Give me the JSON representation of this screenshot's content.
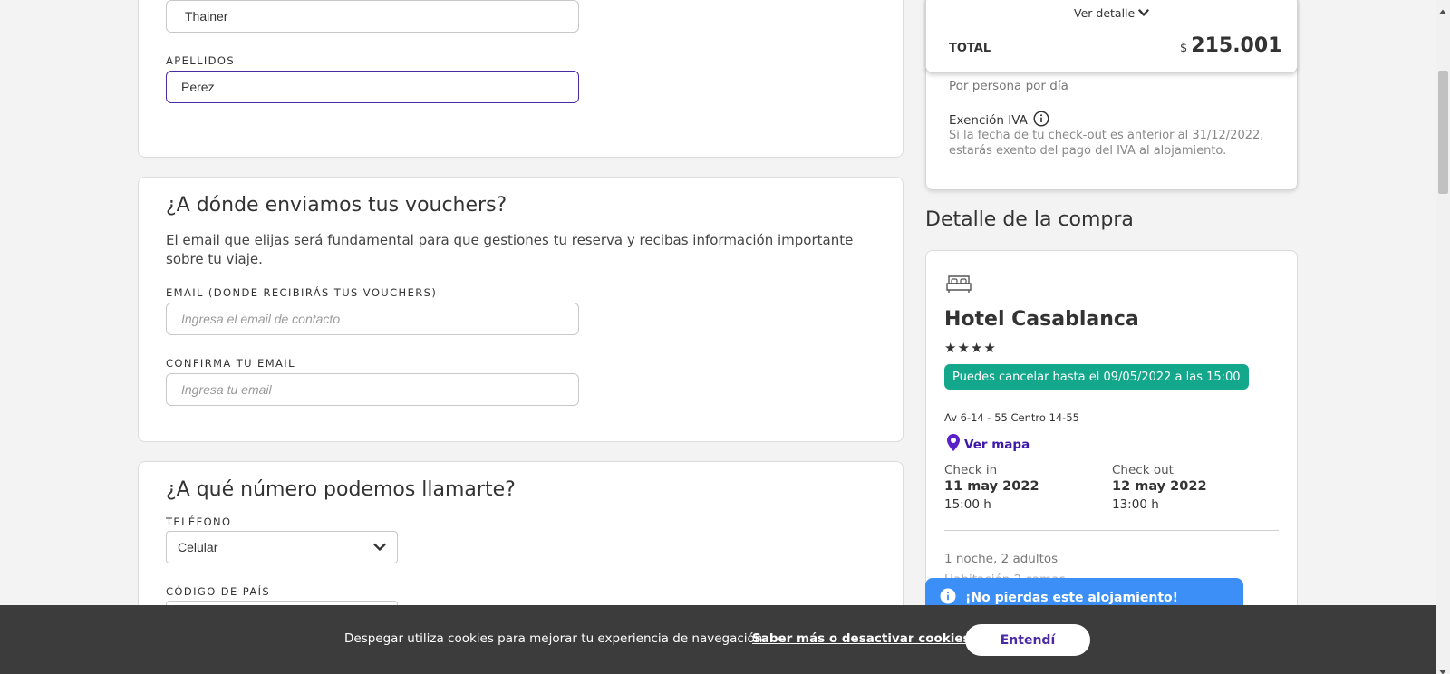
{
  "name_card": {
    "first_name_value": "Thainer",
    "last_name_label": "APELLIDOS",
    "last_name_value": "Perez"
  },
  "email_card": {
    "title": "¿A dónde enviamos tus vouchers?",
    "description": "El email que elijas será fundamental para que gestiones tu reserva y recibas información importante sobre tu viaje.",
    "email_label": "EMAIL (DONDE RECIBIRÁS TUS VOUCHERS)",
    "email_placeholder": "Ingresa el email de contacto",
    "confirm_label": "CONFIRMA TU EMAIL",
    "confirm_placeholder": "Ingresa tu email"
  },
  "phone_card": {
    "title": "¿A qué número podemos llamarte?",
    "phone_label": "TELÉFONO",
    "phone_type_value": "Celular",
    "country_code_label": "CÓDIGO DE PAÍS"
  },
  "price_box": {
    "ver_detalle": "Ver detalle",
    "total_label": "TOTAL",
    "currency": "$",
    "total_value": "215.001",
    "per_person": "Por persona por día",
    "iva_title": "Exención IVA",
    "iva_text": "Si la fecha de tu check-out es anterior al 31/12/2022, estarás exento del pago del IVA al alojamiento."
  },
  "purchase_detail": {
    "title": "Detalle de la compra",
    "hotel_name": "Hotel Casablanca",
    "stars": "★★★★",
    "cancel_badge": "Puedes cancelar hasta el 09/05/2022 a las 15:00",
    "address": "Av 6-14 - 55 Centro 14-55",
    "map_link": "Ver mapa",
    "checkin_label": "Check in",
    "checkin_date": "11 may 2022",
    "checkin_time": "15:00 h",
    "checkout_label": "Check out",
    "checkout_date": "12 may 2022",
    "checkout_time": "13:00 h",
    "summary": "1 noche, 2 adultos",
    "room_partial": "Habitación 2 camas"
  },
  "toast": {
    "text": "¡No pierdas este alojamiento!"
  },
  "cookie_bar": {
    "text": "Despegar utiliza cookies para mejorar tu experiencia de navegación.",
    "link": "Saber más o desactivar cookies.",
    "button": "Entendí"
  },
  "colors": {
    "accent_purple": "#4a2aa6",
    "badge_teal": "#13a88b",
    "toast_blue": "#3b8ff7",
    "cookie_bg": "#3c3c3c"
  }
}
